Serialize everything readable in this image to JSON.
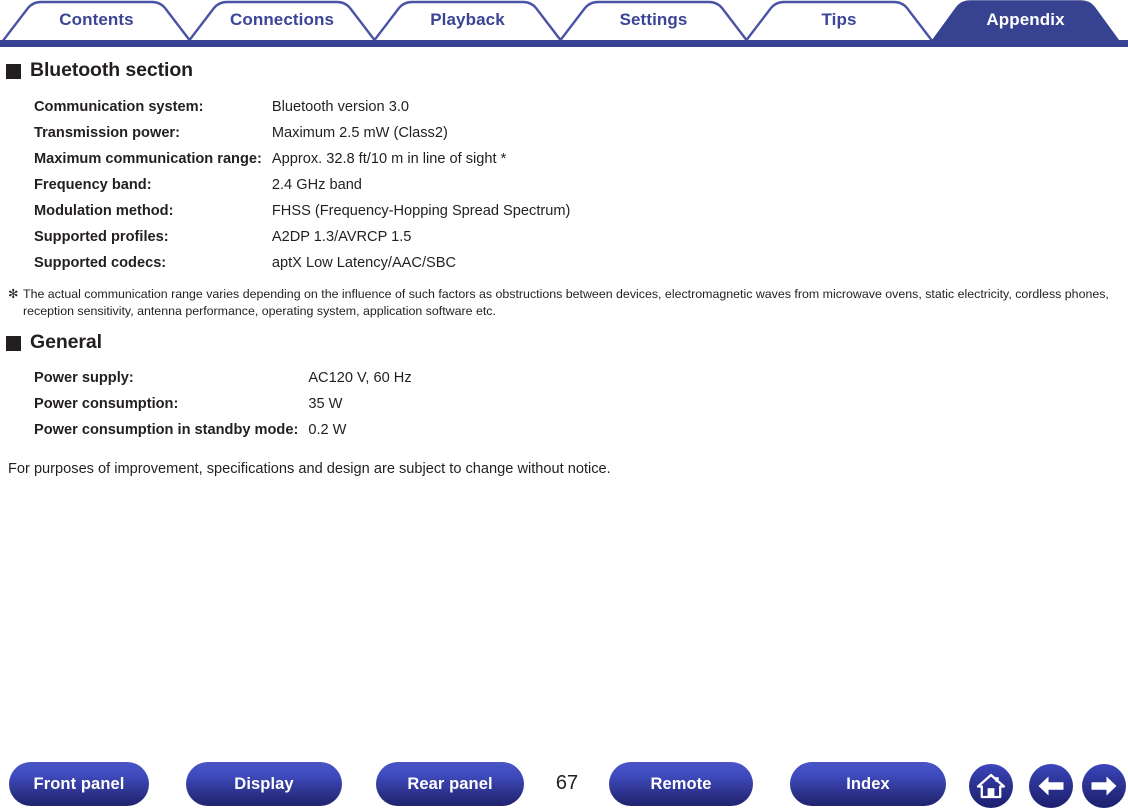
{
  "theme": {
    "tab_blue": "#3b4596",
    "tab_bar_blue": "#374291",
    "button_blue_light": "#4a56c8",
    "button_blue_dark": "#20246e",
    "text_black": "#231f20"
  },
  "tabs": [
    {
      "label": "Contents",
      "active": false
    },
    {
      "label": "Connections",
      "active": false
    },
    {
      "label": "Playback",
      "active": false
    },
    {
      "label": "Settings",
      "active": false
    },
    {
      "label": "Tips",
      "active": false
    },
    {
      "label": "Appendix",
      "active": true
    }
  ],
  "sections": [
    {
      "title": "Bluetooth section",
      "rows": [
        {
          "key": "Communication system:",
          "value": "Bluetooth version 3.0"
        },
        {
          "key": "Transmission power:",
          "value": "Maximum 2.5 mW (Class2)"
        },
        {
          "key": "Maximum communication range:",
          "value": "Approx. 32.8 ft/10 m in line of sight *"
        },
        {
          "key": "Frequency band:",
          "value": "2.4 GHz band"
        },
        {
          "key": "Modulation method:",
          "value": "FHSS (Frequency-Hopping Spread Spectrum)"
        },
        {
          "key": "Supported profiles:",
          "value": "A2DP 1.3/AVRCP 1.5"
        },
        {
          "key": "Supported codecs:",
          "value": "aptX Low Latency/AAC/SBC"
        }
      ]
    },
    {
      "title": "General",
      "rows": [
        {
          "key": "Power supply:",
          "value": "AC120 V, 60 Hz"
        },
        {
          "key": "Power consumption:",
          "value": "35 W"
        },
        {
          "key": "Power consumption in standby mode:",
          "value": "0.2 W"
        }
      ]
    }
  ],
  "footnote": {
    "marker": "✻",
    "text": "The actual communication range varies depending on the influence of such factors as obstructions between devices, electromagnetic waves from microwave ovens, static electricity, cordless phones, reception sensitivity, antenna performance, operating system, application software etc."
  },
  "closing_note": "For purposes of improvement, specifications and design are subject to change without notice.",
  "footer": {
    "buttons": [
      {
        "label": "Front panel"
      },
      {
        "label": "Display"
      },
      {
        "label": "Rear panel"
      },
      {
        "label": "Remote"
      },
      {
        "label": "Index"
      }
    ],
    "page_number": "67",
    "icons": [
      {
        "name": "home-icon"
      },
      {
        "name": "back-arrow-icon"
      },
      {
        "name": "forward-arrow-icon"
      }
    ]
  }
}
